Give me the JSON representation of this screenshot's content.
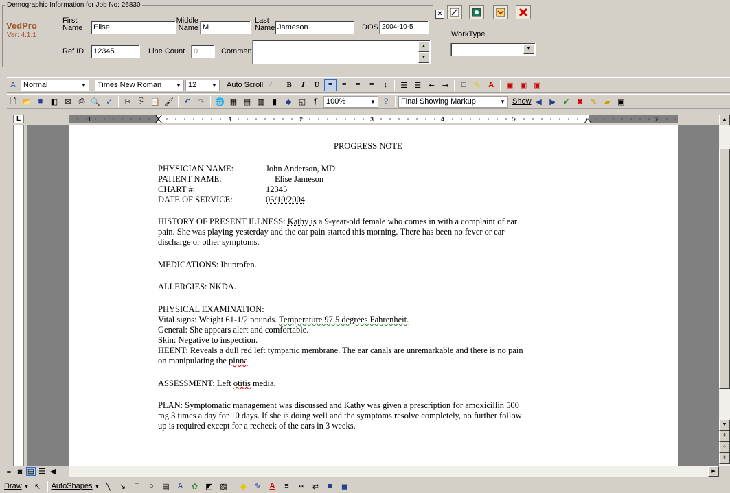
{
  "demographics": {
    "legend": "Demographic Information for Job No: 26830",
    "brand": "VedPro",
    "version": "Ver: 4.1.1",
    "first_name_label": [
      "First",
      "Name"
    ],
    "first_name": "Elise",
    "middle_name_label": [
      "Middle",
      "Name"
    ],
    "middle_name": "M",
    "last_name_label": [
      "Last",
      "Name"
    ],
    "last_name": "Jameson",
    "dos_label": "DOS",
    "dos": "2004-10-5",
    "refid_label": "Ref ID",
    "refid": "12345",
    "linecount_label": "Line Count",
    "linecount": "0",
    "comments_label": "Comments",
    "comments": "",
    "worktype_label": "WorkType",
    "worktype": "",
    "close_glyph": "×"
  },
  "formatting_toolbar": {
    "style": "Normal",
    "font": "Times New Roman",
    "size": "12",
    "auto_scroll": "Auto Scroll",
    "bold": "B",
    "italic": "I",
    "underline": "U"
  },
  "standard_toolbar": {
    "zoom": "100%",
    "markup": "Final Showing Markup",
    "show": "Show"
  },
  "ruler": {
    "numbers": [
      "1",
      "1",
      "2",
      "3",
      "4",
      "5",
      "7"
    ]
  },
  "document": {
    "title": "PROGRESS NOTE",
    "physician_label": "PHYSICIAN NAME:",
    "physician": "John Anderson, MD",
    "patient_label": "PATIENT NAME:",
    "patient": "Elise Jameson",
    "chart_label": "CHART #:",
    "chart": "12345",
    "dos_label": "DATE OF SERVICE:",
    "dos": "05/10/2004",
    "hpi_1a": "HISTORY OF PRESENT ILLNESS: ",
    "hpi_1b": "Kathy  is",
    "hpi_1c": " a 9-year-old female who comes in with a complaint of ear",
    "hpi_2": "pain. She was playing yesterday and the ear pain started this morning. There has been no fever or ear",
    "hpi_3": "discharge or other symptoms.",
    "medications": "MEDICATIONS: Ibuprofen.",
    "allergies": "ALLERGIES: NKDA.",
    "pe_title": "PHYSICAL EXAMINATION:",
    "vitals_a": "Vital signs: Weight 61-1/2 pounds. ",
    "vitals_b": "Temperature 97.5 degrees Fahrenheit.",
    "general": "General: She appears alert and comfortable.",
    "skin": "Skin: Negative to inspection.",
    "heent_1": "HEENT: Reveals a dull red left tympanic membrane. The ear canals are unremarkable and there is no pain",
    "heent_2a": "on manipulating the ",
    "heent_2b": "pinna",
    "heent_2c": ".",
    "assessment_a": "ASSESSMENT: Left ",
    "assessment_b": "otitis",
    "assessment_c": " media.",
    "plan_1": "PLAN: Symptomatic management was discussed and Kathy was given a prescription for amoxicillin 500",
    "plan_2": "mg 3 times a day for 10 days. If she is doing well and the symptoms resolve completely, no further follow",
    "plan_3": "up is required except for a recheck of the ears in 3 weeks."
  },
  "draw_toolbar": {
    "draw": "Draw",
    "autoshapes": "AutoShapes"
  }
}
